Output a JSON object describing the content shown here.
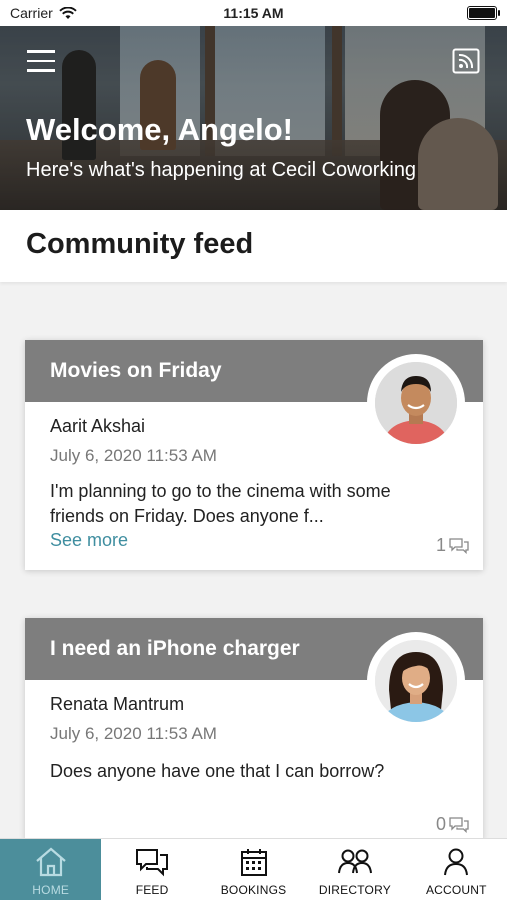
{
  "statusbar": {
    "carrier": "Carrier",
    "time": "11:15 AM"
  },
  "header": {
    "welcome": "Welcome, Angelo!",
    "subtitle": "Here's what's happening at Cecil Coworking"
  },
  "feed": {
    "title": "Community feed",
    "posts": [
      {
        "title": "Movies on Friday",
        "author": "Aarit Akshai",
        "date": "July 6, 2020 11:53 AM",
        "body": "I'm planning to go to the cinema with some friends on Friday. Does anyone f...",
        "see_more": "See more",
        "comments": "1"
      },
      {
        "title": "I need an iPhone charger",
        "author": "Renata Mantrum",
        "date": "July 6, 2020 11:53 AM",
        "body": "Does anyone have one that I can borrow?",
        "comments": "0"
      }
    ]
  },
  "tabs": [
    {
      "label": "HOME",
      "icon": "home-icon",
      "active": true
    },
    {
      "label": "FEED",
      "icon": "chat-icon"
    },
    {
      "label": "BOOKINGS",
      "icon": "calendar-icon"
    },
    {
      "label": "DIRECTORY",
      "icon": "people-icon"
    },
    {
      "label": "ACCOUNT",
      "icon": "person-icon"
    }
  ],
  "colors": {
    "accent": "#4c8e9b",
    "link": "#3f8ea0",
    "card_bar": "#7e7e7e"
  }
}
